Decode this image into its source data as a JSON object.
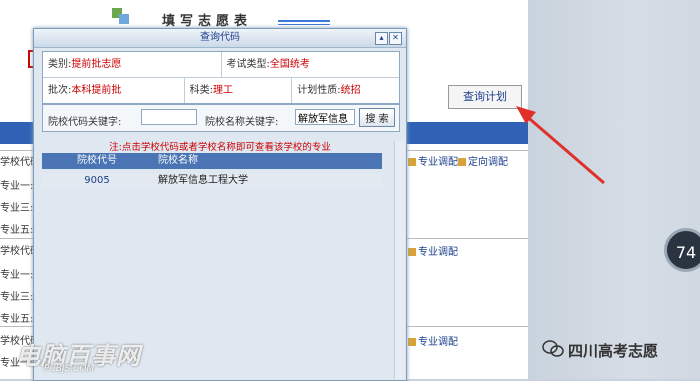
{
  "page": {
    "title": "填写志愿表",
    "query_plan_link": "查询计划",
    "bg_rows": [
      "学校代码",
      "专业一:",
      "专业三:",
      "专业五:",
      "学校代码",
      "专业一:",
      "专业三:",
      "专业五:",
      "学校代码",
      "专业一:"
    ],
    "bg_right": [
      "专业调配",
      "定向调配",
      "专业调配",
      "专业调配"
    ]
  },
  "dialog": {
    "title": "查询代码",
    "minimize_symbol": "▴",
    "close_symbol": "✕",
    "info": {
      "category_label": "类别:",
      "category_value": "提前批志愿",
      "exam_type_label": "考试类型:",
      "exam_type_value": "全国统考",
      "batch_label": "批次:",
      "batch_value": "本科提前批",
      "subject_label": "科类:",
      "subject_value": "理工",
      "plan_type_label": "计划性质:",
      "plan_type_value": "统招"
    },
    "search": {
      "code_label": "院校代码关键字:",
      "code_value": "",
      "name_label": "院校名称关键字:",
      "name_value": "解放军信息",
      "search_button": "搜 索"
    },
    "note": "注:点击学校代码或者学校名称即可查看该学校的专业",
    "results": {
      "headers": [
        "院校代号",
        "院校名称"
      ],
      "rows": [
        {
          "code": "9005",
          "name": "解放军信息工程大学"
        }
      ]
    }
  },
  "overlay": {
    "badge_number": "74",
    "watermark_right": "四川高考志愿",
    "watermark_left": "电脑百事网",
    "watermark_left_sub": "PCBJS.COM"
  },
  "colors": {
    "arrow": "#e0302a",
    "accent_blue": "#2f62b4",
    "highlight_red": "#cc0000"
  }
}
